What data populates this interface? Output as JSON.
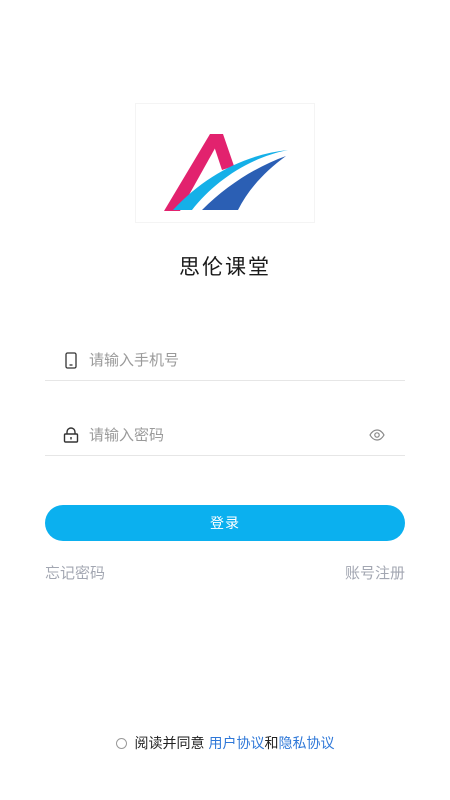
{
  "app": {
    "name": "思伦课堂"
  },
  "phone": {
    "icon": "phone-icon",
    "placeholder": "请输入手机号",
    "value": ""
  },
  "password": {
    "icon": "lock-icon",
    "placeholder": "请输入密码",
    "value": "",
    "toggle_icon": "eye-icon"
  },
  "login": {
    "label": "登录",
    "color": "#0bb0ef"
  },
  "links": {
    "forgot": "忘记密码",
    "register": "账号注册"
  },
  "agreement": {
    "prefix": "阅读并同意",
    "user_agreement": "用户协议",
    "and": "和",
    "privacy_agreement": "隐私协议",
    "checked": false,
    "link_color": "#2f78d8"
  },
  "logo": {
    "colors": [
      "#e2226e",
      "#15b0e8",
      "#2b5fb4"
    ]
  }
}
